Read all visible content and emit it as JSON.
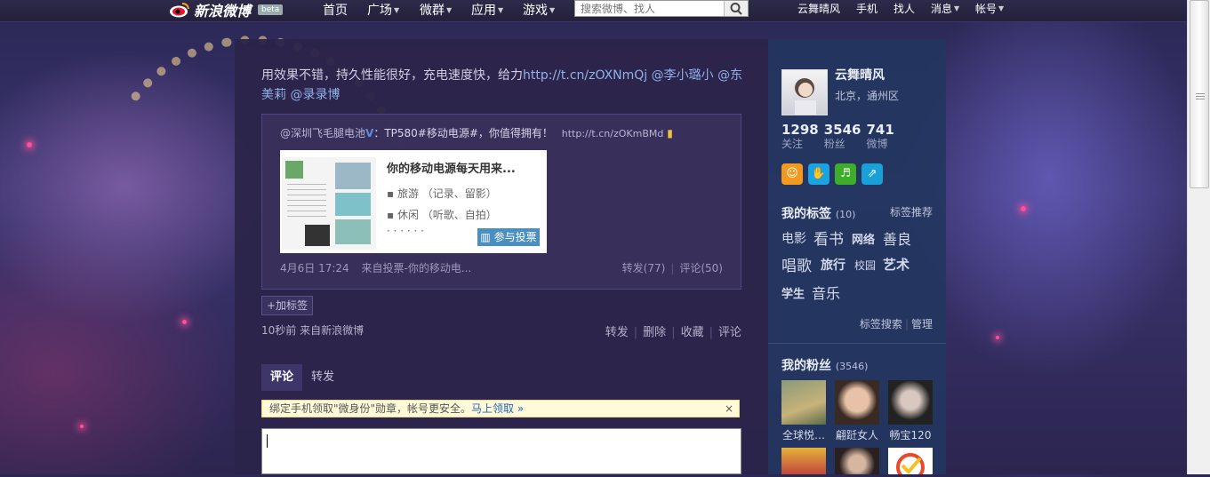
{
  "header": {
    "logo_text": "新浪微博",
    "logo_badge": "beta",
    "nav": [
      {
        "label": "首页",
        "has_dropdown": false
      },
      {
        "label": "广场",
        "has_dropdown": true
      },
      {
        "label": "微群",
        "has_dropdown": true
      },
      {
        "label": "应用",
        "has_dropdown": true
      },
      {
        "label": "游戏",
        "has_dropdown": true
      }
    ],
    "search_placeholder": "搜索微博、找人",
    "right_nav": [
      {
        "label": "云舞晴风",
        "has_dropdown": false
      },
      {
        "label": "手机",
        "has_dropdown": false
      },
      {
        "label": "找人",
        "has_dropdown": false
      },
      {
        "label": "消息",
        "has_dropdown": true
      },
      {
        "label": "帐号",
        "has_dropdown": true
      }
    ]
  },
  "post": {
    "text_before": "用效果不错，持久性能很好，充电速度快，给力",
    "link": "http://t.cn/zOXNmQj",
    "mentions": "@李小璐小 @东美莉 @录录博",
    "repost": {
      "author": "@深圳飞毛腿电池",
      "text": "：TP580#移动电源#，你值得拥有！",
      "link": "http://t.cn/zOKmBMd",
      "card": {
        "title": "你的移动电源每天用来...",
        "line1": "旅游 （记录、留影）",
        "line2": "休闲 （听歌、自拍）",
        "line3": "· · ·  · · ·",
        "button": "参与投票"
      },
      "time": "4月6日 17:24",
      "source": "来自投票-你的移动电...",
      "forward": "转发(77)",
      "comment": "评论(50)"
    },
    "add_tag": "+加标签",
    "meta": "10秒前 来自新浪微博",
    "actions": [
      "转发",
      "删除",
      "收藏",
      "评论"
    ]
  },
  "comments": {
    "tabs": [
      "评论",
      "转发"
    ],
    "notice_text": "绑定手机领取\"微身份\"勋章，帐号更安全。",
    "notice_link": "马上领取 »",
    "notice_close": "×"
  },
  "profile": {
    "name": "云舞晴风",
    "location": "北京，通州区",
    "stats": [
      {
        "num": "1298",
        "label": "关注"
      },
      {
        "num": "3546",
        "label": "粉丝"
      },
      {
        "num": "741",
        "label": "微博"
      }
    ],
    "badge_colors": [
      "#f39a1e",
      "#1aa3e0",
      "#3cae2a",
      "#19a0d8"
    ],
    "tags_title": "我的标签",
    "tags_count": "(10)",
    "tags_recommend": "标签推荐",
    "tags": [
      "电影",
      "看书",
      "网络",
      "善良",
      "唱歌",
      "旅行",
      "校园",
      "艺术",
      "学生",
      "音乐"
    ],
    "tag_search": "标签搜索",
    "tag_manage": "管理",
    "fans_title": "我的粉丝",
    "fans_count": "(3546)",
    "fans": [
      {
        "name": "全球悦…"
      },
      {
        "name": "翩跹女人"
      },
      {
        "name": "畅宝120"
      }
    ]
  }
}
